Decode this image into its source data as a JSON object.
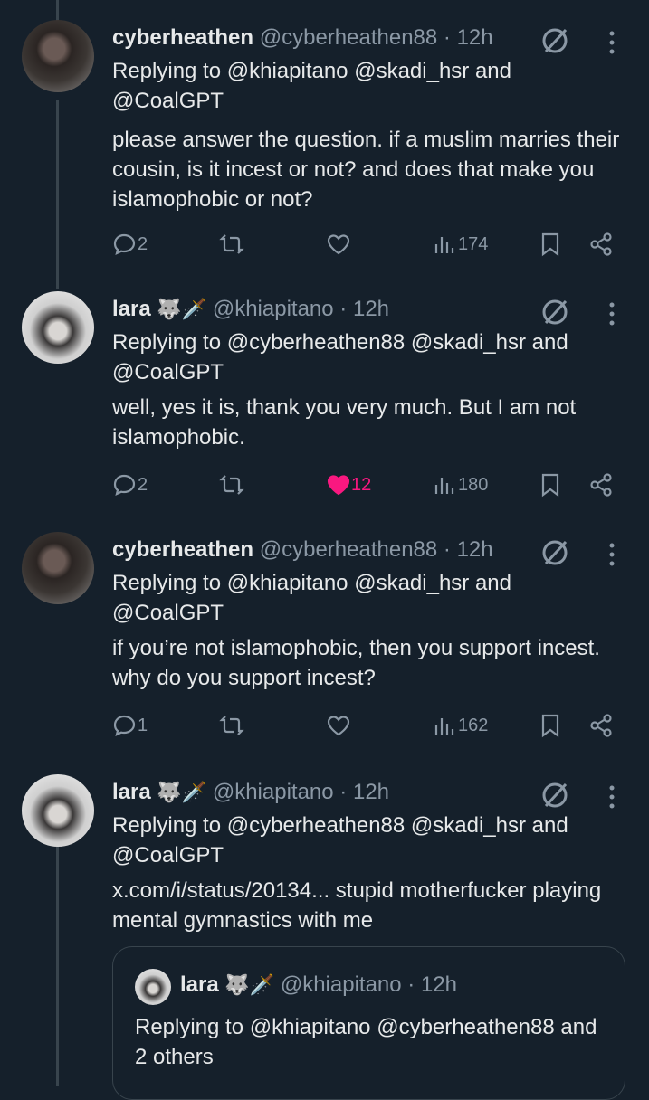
{
  "tweets": [
    {
      "name": "cyberheathen",
      "handle": "@cyberheathen88",
      "separator": "·",
      "time": "12h",
      "emoji": "",
      "reply_prefix": "Replying to",
      "reply_to": "@khiapitano @skadi_hsr and @CoalGPT",
      "body": "please answer the question. if a muslim marries their cousin, is it incest or not? and does that make you islamophobic or not?",
      "replies": "2",
      "retweets": "",
      "likes": "",
      "views": "174",
      "liked": false
    },
    {
      "name": "lara",
      "handle": "@khiapitano",
      "separator": "·",
      "time": "12h",
      "emoji": "🐺🗡️",
      "reply_prefix": "Replying to",
      "reply_to": "@cyberheathen88 @skadi_hsr and @CoalGPT",
      "body": "well, yes it is, thank you very much. But I am not islamophobic.",
      "replies": "2",
      "retweets": "",
      "likes": "12",
      "views": "180",
      "liked": true
    },
    {
      "name": "cyberheathen",
      "handle": "@cyberheathen88",
      "separator": "·",
      "time": "12h",
      "emoji": "",
      "reply_prefix": "Replying to",
      "reply_to": "@khiapitano @skadi_hsr and @CoalGPT",
      "body": "if you’re not islamophobic, then you support incest. why do you support incest?",
      "replies": "1",
      "retweets": "",
      "likes": "",
      "views": "162",
      "liked": false
    },
    {
      "name": "lara",
      "handle": "@khiapitano",
      "separator": "·",
      "time": "12h",
      "emoji": "🐺🗡️",
      "reply_prefix": "Replying to",
      "reply_to": "@cyberheathen88 @skadi_hsr and @CoalGPT",
      "body": "x.com/i/status/20134... stupid motherfucker playing mental gymnastics with me"
    }
  ],
  "quote": {
    "name": "lara",
    "emoji": "🐺🗡️",
    "handle": "@khiapitano",
    "separator": "·",
    "time": "12h",
    "reply_prefix": "Replying to",
    "reply_to": "@khiapitano @cyberheathen88 and 2 others"
  },
  "colors": {
    "background": "#15202b",
    "text": "#e7e9ea",
    "muted": "#8b98a5",
    "like": "#f91880",
    "line": "#38444d"
  },
  "icons": [
    "circle-slash-icon",
    "more-vertical-icon",
    "reply-icon",
    "retweet-icon",
    "like-icon",
    "views-icon",
    "bookmark-icon",
    "share-icon"
  ]
}
